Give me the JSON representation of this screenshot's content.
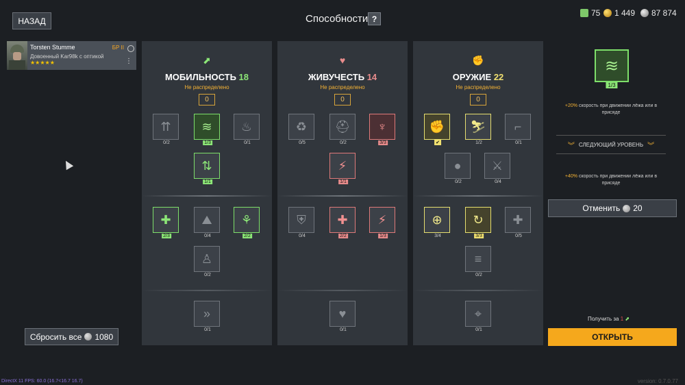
{
  "header": {
    "back_label": "НАЗАД",
    "title": "Способности",
    "help_label": "?",
    "currencies": [
      {
        "icon": "ticket-icon",
        "value": "75",
        "color": "#7ec86a"
      },
      {
        "icon": "gold-coin-icon",
        "value": "1 449",
        "color": "#e6b030"
      },
      {
        "icon": "silver-coin-icon",
        "value": "87 874",
        "color": "#bdbdbd"
      }
    ]
  },
  "soldier": {
    "name": "Torsten Stumme",
    "rank": "БР II",
    "role": "Довоенный Kar98k с оптикой",
    "stars": "★★★★★"
  },
  "reset": {
    "label": "Сбросить все",
    "cost": "1080"
  },
  "columns": [
    {
      "title": "МОБИЛЬНОСТЬ",
      "points": "18",
      "points_color": "#8ce677",
      "icon": "⬈",
      "icon_color": "#8ce677",
      "unassigned_label": "Не распределено",
      "unassigned_value": "0",
      "skills": [
        {
          "name": "climb-skill-icon",
          "glyph": "⇈",
          "level": "0/2",
          "style": ""
        },
        {
          "name": "crawl-skill-icon",
          "glyph": "≋",
          "level": "1/3",
          "style": "green"
        },
        {
          "name": "fire-resist-skill-icon",
          "glyph": "♨",
          "level": "0/1",
          "style": ""
        },
        {
          "name": "crouch-skill-icon",
          "glyph": "⇅",
          "level": "1/1",
          "style": "green2"
        },
        {
          "name": "heal-move-skill-icon",
          "glyph": "✚",
          "level": "2/3",
          "style": "green2"
        },
        {
          "name": "vault-skill-icon",
          "glyph": "⛰",
          "level": "0/4",
          "style": ""
        },
        {
          "name": "stamina-skill-icon",
          "glyph": "⚘",
          "level": "2/2",
          "style": "green2"
        },
        {
          "name": "walk-skill-icon",
          "glyph": "♙",
          "level": "0/2",
          "style": ""
        },
        {
          "name": "sprint-skill-icon",
          "glyph": "»",
          "level": "0/1",
          "style": ""
        }
      ]
    },
    {
      "title": "ЖИВУЧЕСТЬ",
      "points": "14",
      "points_color": "#e88c8c",
      "icon": "♥",
      "icon_color": "#e88c8c",
      "unassigned_label": "Не распределено",
      "unassigned_value": "0",
      "skills": [
        {
          "name": "revive-skill-icon",
          "glyph": "♻",
          "level": "0/5",
          "style": ""
        },
        {
          "name": "helmet-skill-icon",
          "glyph": "⛑",
          "level": "0/2",
          "style": ""
        },
        {
          "name": "lungs-skill-icon",
          "glyph": "♆",
          "level": "3/3",
          "style": "red"
        },
        {
          "name": "shock-skill-icon",
          "glyph": "⚡",
          "level": "1/1",
          "style": "red2"
        },
        {
          "name": "armor-skill-icon",
          "glyph": "⛨",
          "level": "0/4",
          "style": ""
        },
        {
          "name": "medkit-skill-icon",
          "glyph": "✚",
          "level": "2/2",
          "style": "red2"
        },
        {
          "name": "energy-skill-icon",
          "glyph": "⚡",
          "level": "1/3",
          "style": "red2"
        },
        {
          "name": "heart-up-skill-icon",
          "glyph": "♥",
          "level": "0/1",
          "style": ""
        }
      ]
    },
    {
      "title": "ОРУЖИЕ",
      "points": "22",
      "points_color": "#f0e070",
      "icon": "✊",
      "icon_color": "#f0e070",
      "unassigned_label": "Не распределено",
      "unassigned_value": "0",
      "skills": [
        {
          "name": "grip-skill-icon",
          "glyph": "✊",
          "level": "✔",
          "style": "yellow"
        },
        {
          "name": "run-gun-skill-icon",
          "glyph": "⛷",
          "level": "1/2",
          "style": "yellow2"
        },
        {
          "name": "pistol-skill-icon",
          "glyph": "⌐",
          "level": "0/1",
          "style": ""
        },
        {
          "name": "grenade-skill-icon",
          "glyph": "●",
          "level": "0/2",
          "style": ""
        },
        {
          "name": "knife-skill-icon",
          "glyph": "⚔",
          "level": "0/4",
          "style": ""
        },
        {
          "name": "aim-skill-icon",
          "glyph": "⊕",
          "level": "3/4",
          "style": "yellow2"
        },
        {
          "name": "reload-skill-icon",
          "glyph": "↻",
          "level": "3/3",
          "style": "yellow"
        },
        {
          "name": "ammo-skill-icon",
          "glyph": "✚",
          "level": "0/5",
          "style": ""
        },
        {
          "name": "bayonet-skill-icon",
          "glyph": "≡",
          "level": "0/2",
          "style": ""
        },
        {
          "name": "focus-skill-icon",
          "glyph": "⌖",
          "level": "0/1",
          "style": ""
        }
      ]
    }
  ],
  "detail": {
    "level": "1/3",
    "glyph": "≋",
    "desc1_highlight": "+20%",
    "desc1_text": " скорость при движении лёжа или в присяде",
    "next_level_label": "СЛЕДУЮЩИЙ УРОВЕНЬ",
    "desc2_highlight": "+40%",
    "desc2_text": " скорость при движении лёжа или в присяде",
    "cancel_label": "Отменить",
    "cancel_cost": "20",
    "get_for_label": "Получить за",
    "get_for_value": "1",
    "open_label": "ОТКРЫТЬ"
  },
  "footer": {
    "fps": "DirectX 11 FPS: 60.0 (16.7<16.7 16.7)",
    "version": "version: 0.7.0.77"
  }
}
